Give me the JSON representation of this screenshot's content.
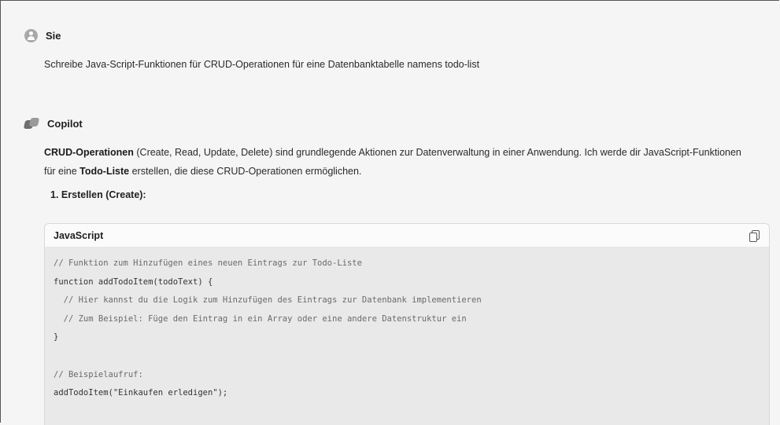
{
  "user_message": {
    "author": "Sie",
    "text": "Schreibe Java-Script-Funktionen für CRUD-Operationen für eine Datenbanktabelle namens todo-list"
  },
  "copilot_message": {
    "author": "Copilot",
    "intro_bold": "CRUD-Operationen",
    "intro_rest1": " (Create, Read, Update, Delete) sind grundlegende Aktionen zur Datenverwaltung in einer Anwendung. Ich werde dir JavaScript-Funktionen für eine ",
    "intro_bold2": "Todo-Liste",
    "intro_rest2": " erstellen, die diese CRUD-Operationen ermöglichen.",
    "step_number": "1.",
    "step_label": "Erstellen (Create):",
    "code_block": {
      "language": "JavaScript",
      "copy_icon": "copy-icon",
      "lines": [
        "// Funktion zum Hinzufügen eines neuen Eintrags zur Todo-Liste",
        "function addTodoItem(todoText) {",
        "  // Hier kannst du die Logik zum Hinzufügen des Eintrags zur Datenbank implementieren",
        "  // Zum Beispiel: Füge den Eintrag in ein Array oder eine andere Datenstruktur ein",
        "}",
        "",
        "// Beispielaufruf:",
        "addTodoItem(\"Einkaufen erledigen\");"
      ]
    }
  }
}
